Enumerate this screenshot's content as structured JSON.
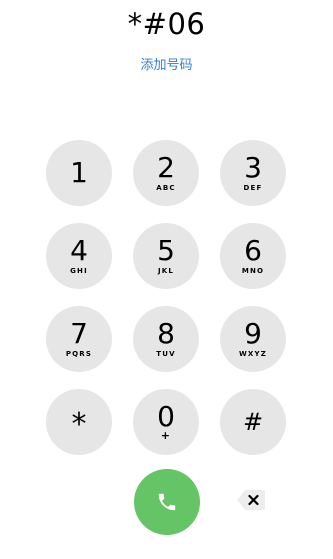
{
  "display": {
    "number": "*#06",
    "add_number_label": "添加号码"
  },
  "keypad": {
    "keys": [
      {
        "digit": "1",
        "letters": ""
      },
      {
        "digit": "2",
        "letters": "ABC"
      },
      {
        "digit": "3",
        "letters": "DEF"
      },
      {
        "digit": "4",
        "letters": "GHI"
      },
      {
        "digit": "5",
        "letters": "JKL"
      },
      {
        "digit": "6",
        "letters": "MNO"
      },
      {
        "digit": "7",
        "letters": "PQRS"
      },
      {
        "digit": "8",
        "letters": "TUV"
      },
      {
        "digit": "9",
        "letters": "WXYZ"
      },
      {
        "digit": "*",
        "letters": ""
      },
      {
        "digit": "0",
        "letters": "+"
      },
      {
        "digit": "#",
        "letters": ""
      }
    ]
  },
  "actions": {
    "call_icon": "phone-handset-icon",
    "delete_icon": "backspace-delete-icon"
  },
  "colors": {
    "key_background": "#e6e6e6",
    "call_green": "#65c466",
    "link_blue": "#2f7fd6"
  }
}
